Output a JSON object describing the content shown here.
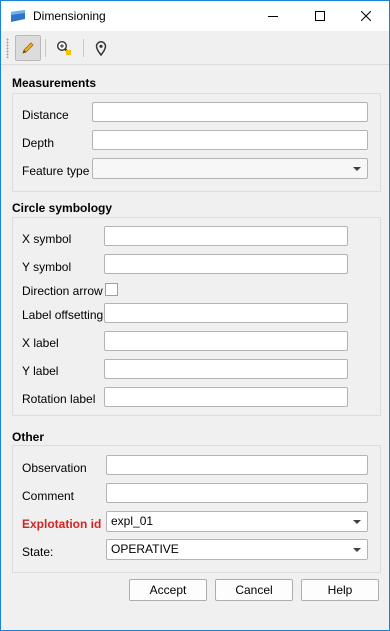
{
  "window": {
    "title": "Dimensioning"
  },
  "icons": {
    "app": "qgis-app-icon",
    "minimize": "minimize-icon",
    "maximize": "maximize-icon",
    "close": "close-icon",
    "tools": [
      "pencil-icon",
      "zoom-to-icon",
      "map-pin-icon"
    ]
  },
  "measurements": {
    "title": "Measurements",
    "distance_label": "Distance",
    "distance_value": "",
    "depth_label": "Depth",
    "depth_value": "",
    "feature_type_label": "Feature type",
    "feature_type_value": ""
  },
  "circle": {
    "title": "Circle symbology",
    "x_symbol_label": "X symbol",
    "y_symbol_label": "Y symbol",
    "direction_arrow_label": "Direction arrow",
    "label_offsetting_label": "Label offsetting",
    "x_label_label": "X label",
    "y_label_label": "Y label",
    "rotation_label_label": "Rotation label"
  },
  "other": {
    "title": "Other",
    "observation_label": "Observation",
    "comment_label": "Comment",
    "explotation_label": "Explotation id",
    "explotation_value": "expl_01",
    "state_label": "State:",
    "state_value": "OPERATIVE"
  },
  "buttons": {
    "accept": "Accept",
    "cancel": "Cancel",
    "help": "Help"
  },
  "colors": {
    "required_label": "#d52323",
    "window_border": "#1883d7"
  }
}
